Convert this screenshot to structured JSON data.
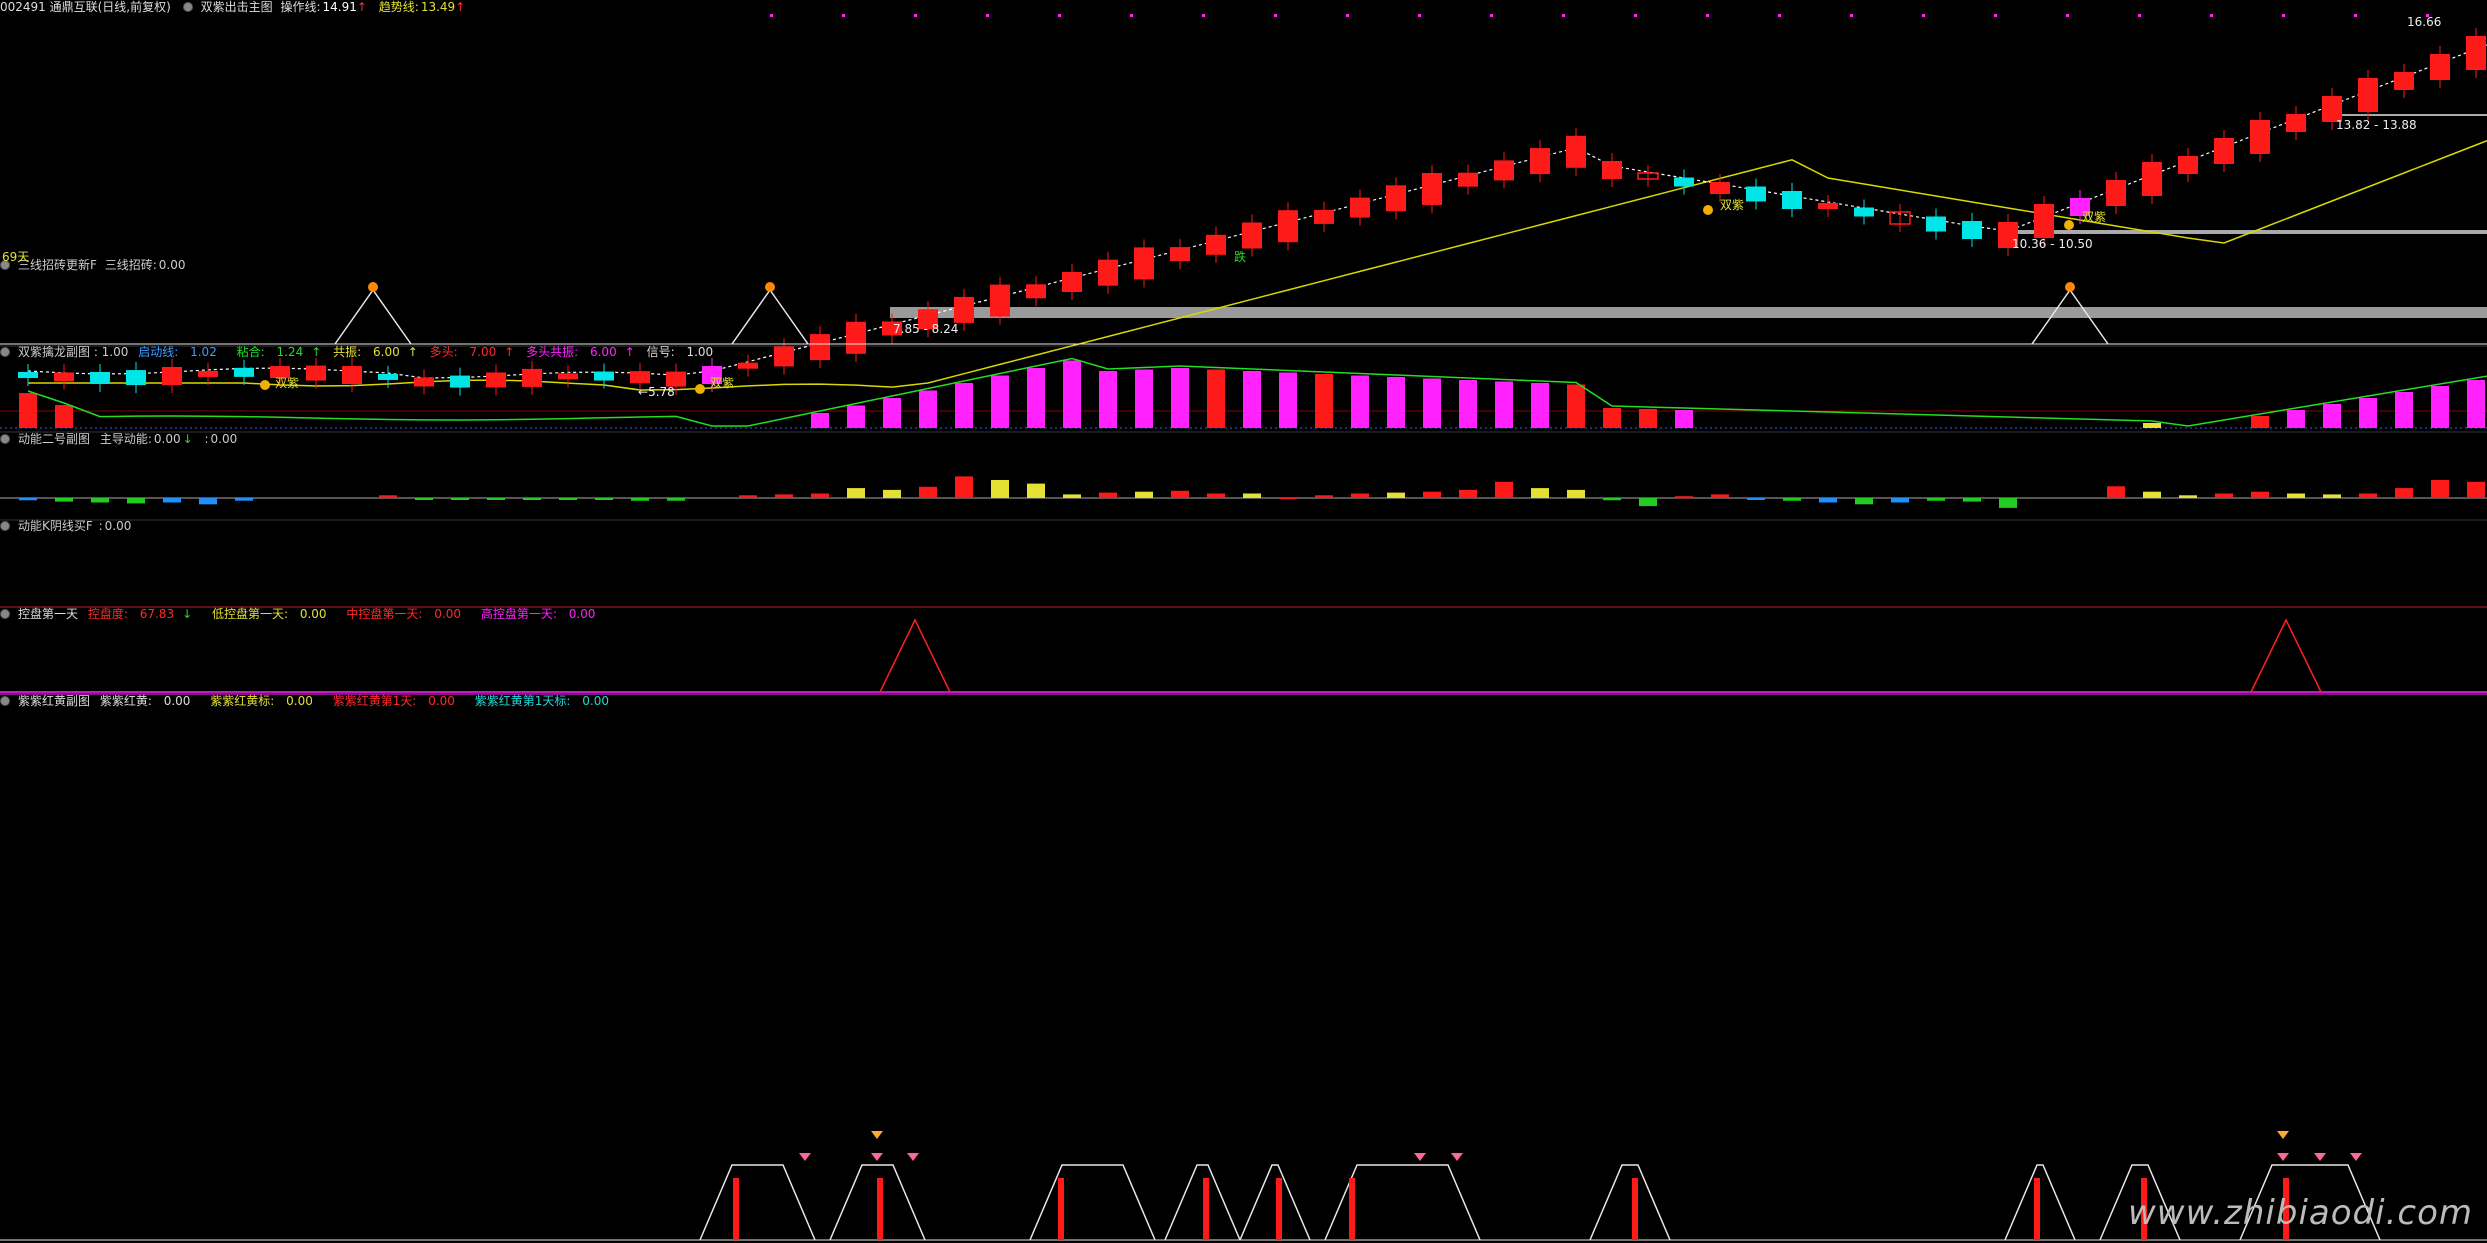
{
  "colors": {
    "up": "#ff1a1a",
    "down": "#00e5e5",
    "magenta": "#ff22ff",
    "yellow": "#e4e034",
    "green": "#22cc22",
    "blue": "#1e90ff",
    "ma": "#d8d800",
    "divider": "#7a0000"
  },
  "panel_main": {
    "title": "002491 通鼎互联(日线,前复权)",
    "indicator_name": "双紫出击主图",
    "op_line_label": "操作线:",
    "op_line_value": "14.91",
    "trend_line_label": "趋势线:",
    "trend_line_value": "13.49",
    "day_count": "69天",
    "mid_marker": "跌",
    "price_labels": [
      "16.66",
      "13.82 - 13.88",
      "10.36 - 10.50",
      "7.85 - 8.24",
      "5.78"
    ],
    "signal_text": "双紫"
  },
  "panel_brick": {
    "title": "三线招砖更新F",
    "v1_label": "三线招砖:",
    "v1_value": "0.00"
  },
  "panel_dragon": {
    "title": "双紫擒龙副图 : 1.00",
    "items": [
      {
        "label": "启动线:",
        "value": "1.02"
      },
      {
        "label": "粘合:",
        "value": "1.24"
      },
      {
        "label": "共振:",
        "value": "6.00"
      },
      {
        "label": "多头:",
        "value": "7.00"
      },
      {
        "label": "多头共振:",
        "value": "6.00"
      },
      {
        "label": "信号:",
        "value": "1.00"
      }
    ]
  },
  "panel_energy": {
    "title": "动能二号副图",
    "v1_label": "主导动能:",
    "v1_value": "0.00",
    "v2_label": ":",
    "v2_value": "0.00"
  },
  "panel_kline": {
    "title": "动能K阴线买F",
    "v1_label": ":",
    "v1_value": "0.00"
  },
  "panel_control": {
    "title": "控盘第一天",
    "items": [
      {
        "label": "控盘度:",
        "value": "67.83"
      },
      {
        "label": "低控盘第一天:",
        "value": "0.00"
      },
      {
        "label": "中控盘第一天:",
        "value": "0.00"
      },
      {
        "label": "高控盘第一天:",
        "value": "0.00"
      }
    ]
  },
  "panel_zihong": {
    "title": "紫紫红黄副图",
    "items": [
      {
        "label": "紫紫红黄:",
        "value": "0.00"
      },
      {
        "label": "紫紫红黄标:",
        "value": "0.00"
      },
      {
        "label": "紫紫红黄第1天:",
        "value": "0.00"
      },
      {
        "label": "紫紫红黄第1天标:",
        "value": "0.00"
      }
    ]
  },
  "watermark": "www.zhibiaodi.com"
}
